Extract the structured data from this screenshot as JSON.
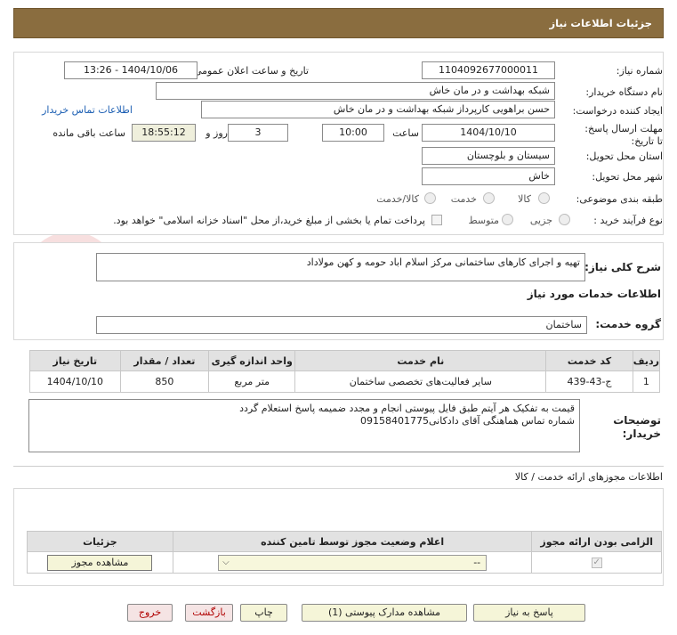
{
  "header": {
    "title": "جزئیات اطلاعات نیاز"
  },
  "form": {
    "need_number_label": "شماره نیاز:",
    "need_number": "1104092677000011",
    "announce_label": "تاریخ و ساعت اعلان عمومی:",
    "announce_value": "1404/10/06 - 13:26",
    "buyer_org_label": "نام دستگاه خریدار:",
    "buyer_org": "شبکه بهداشت و در مان خاش",
    "creator_label": "ایجاد کننده درخواست:",
    "creator": "حسن براهویی کارپرداز شبکه بهداشت و در مان خاش",
    "contact_link": "اطلاعات تماس خریدار",
    "deadline_label": "مهلت ارسال پاسخ: تا تاریخ:",
    "deadline_date": "1404/10/10",
    "time_label": "ساعت",
    "deadline_time": "10:00",
    "days_label": "روز و",
    "days": "3",
    "remaining_time": "18:55:12",
    "remaining_label": "ساعت باقی مانده",
    "province_label": "استان محل تحویل:",
    "province": "سیستان و بلوچستان",
    "city_label": "شهر محل تحویل:",
    "city": "خاش",
    "category_label": "طبقه بندی موضوعی:",
    "category_options": [
      "کالا",
      "خدمت",
      "کالا/خدمت"
    ],
    "process_label": "نوع فرآیند خرید :",
    "process_options": [
      "جزیی",
      "متوسط"
    ],
    "treasury_note": "پرداخت تمام یا بخشی از مبلغ خرید،از محل \"اسناد خزانه اسلامی\" خواهد بود."
  },
  "description": {
    "label": "شرح کلی نیاز:",
    "value": "تهیه و اجرای کارهای ساختمانی مرکز اسلام اباد حومه و کهن مولاداد"
  },
  "services": {
    "section_title": "اطلاعات خدمات مورد نیاز",
    "group_label": "گروه خدمت:",
    "group_value": "ساختمان",
    "columns": [
      "ردیف",
      "کد خدمت",
      "نام خدمت",
      "واحد اندازه گیری",
      "تعداد / مقدار",
      "تاریخ نیاز"
    ],
    "rows": [
      {
        "row": "1",
        "code": "ج-43-439",
        "name": "سایر فعالیت‌های تخصصی ساختمان",
        "unit": "متر مربع",
        "qty": "850",
        "date": "1404/10/10"
      }
    ]
  },
  "notes": {
    "label": "توضیحات خریدار:",
    "line1": "قیمت به تفکیک هر آیتم طبق فایل پیوستی انجام و مجدد ضمیمه پاسخ استعلام گردد",
    "line2": "شماره تماس هماهنگی آقای دادکانی09158401775"
  },
  "permits": {
    "section_title": "اطلاعات مجوزهای ارائه خدمت / کالا",
    "columns": [
      "الزامی بودن ارائه مجوز",
      "اعلام وضعیت مجوز توسط تامین کننده",
      "جزئیات"
    ],
    "select_value": "--",
    "view_button": "مشاهده مجوز"
  },
  "footer": {
    "reply": "پاسخ به نیاز",
    "attachments": "مشاهده مدارک پیوستی (1)",
    "print": "چاپ",
    "back": "بازگشت",
    "exit": "خروج"
  },
  "watermark": {
    "text": "AriaTender.net"
  }
}
